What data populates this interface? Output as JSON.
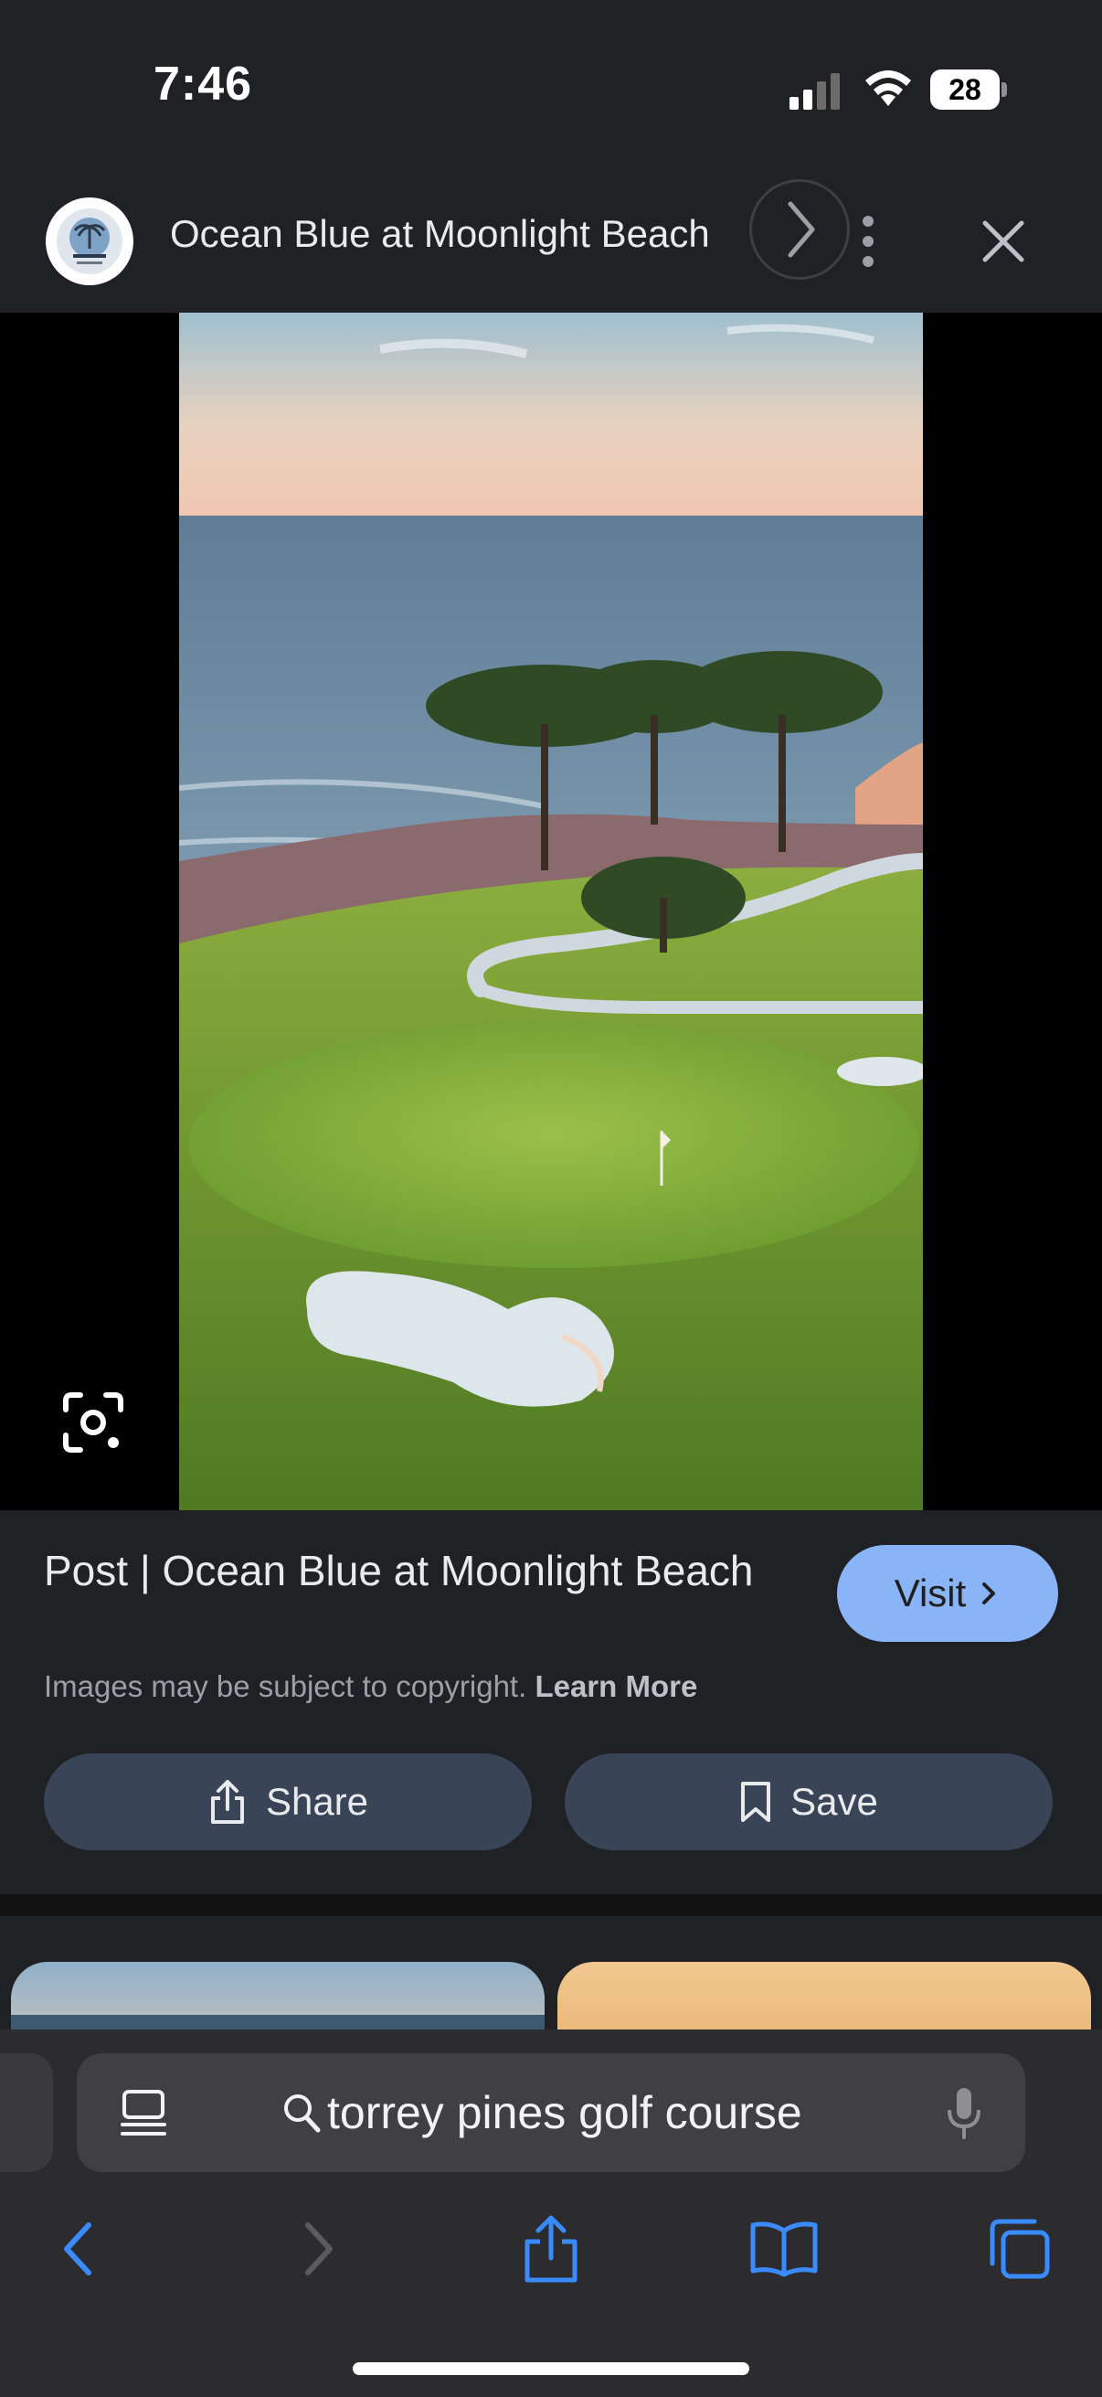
{
  "status": {
    "time": "7:46",
    "battery": "28"
  },
  "header": {
    "site_title": "Ocean Blue at Moonlight Beach"
  },
  "result": {
    "title": "Post | Ocean Blue at Moonlight Beach",
    "visit_label": "Visit",
    "copyright_text": "Images may be subject to copyright.",
    "learn_more": "Learn More",
    "share_label": "Share",
    "save_label": "Save"
  },
  "browser": {
    "address_text": "torrey pines golf course"
  },
  "colors": {
    "accent": "#8ab4f8",
    "safari_blue": "#3a8bff",
    "pill_bg": "#394457"
  },
  "icons": [
    "signal-icon",
    "wifi-icon",
    "battery-icon",
    "chevron-right-icon",
    "more-vert-icon",
    "close-icon",
    "lens-icon",
    "share-icon",
    "bookmark-icon",
    "reader-icon",
    "search-icon",
    "mic-icon",
    "back-icon",
    "forward-icon",
    "safari-share-icon",
    "bookmarks-icon",
    "tabs-icon"
  ]
}
